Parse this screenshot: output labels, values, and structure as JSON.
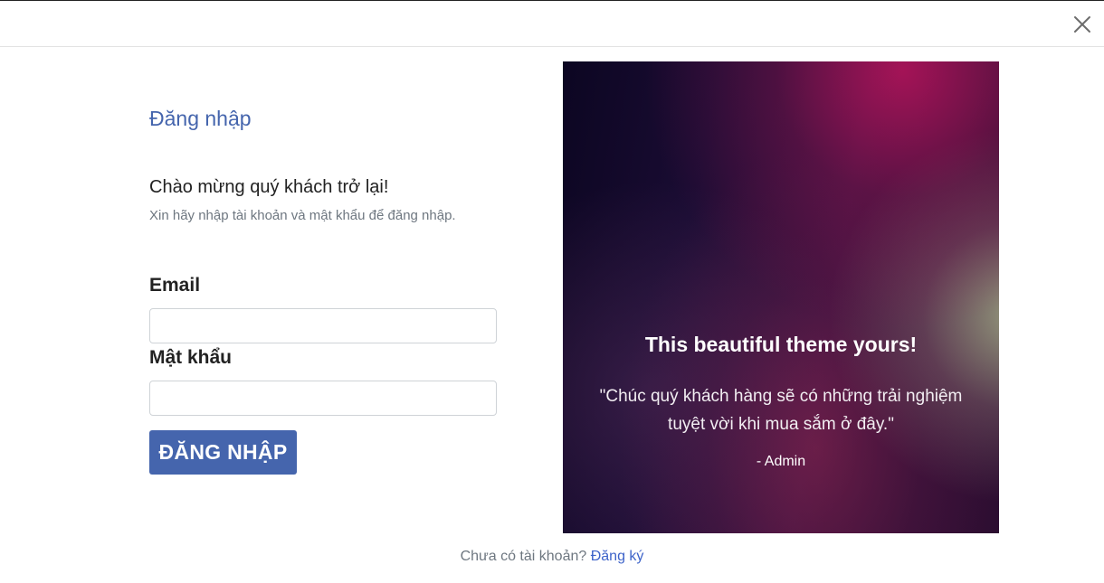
{
  "header": {
    "close_icon": "close-icon"
  },
  "login": {
    "title": "Đăng nhập",
    "welcome_heading": "Chào mừng quý khách trở lại!",
    "welcome_subtitle": "Xin hãy nhập tài khoản và mật khẩu để đăng nhập.",
    "email_label": "Email",
    "email_value": "",
    "password_label": "Mật khẩu",
    "password_value": "",
    "submit_label": "ĐĂNG NHẬP"
  },
  "promo": {
    "heading": "This beautiful theme yours!",
    "quote": "\"Chúc quý khách hàng sẽ có những trải nghiệm tuyệt vời khi mua sắm ở đây.\"",
    "author": "- Admin"
  },
  "footer": {
    "signup_prompt": "Chưa có tài khoản?",
    "signup_link": "Đăng ký"
  },
  "colors": {
    "accent": "#4565ad",
    "link": "#3d63c9",
    "muted_text": "#6e7780"
  }
}
